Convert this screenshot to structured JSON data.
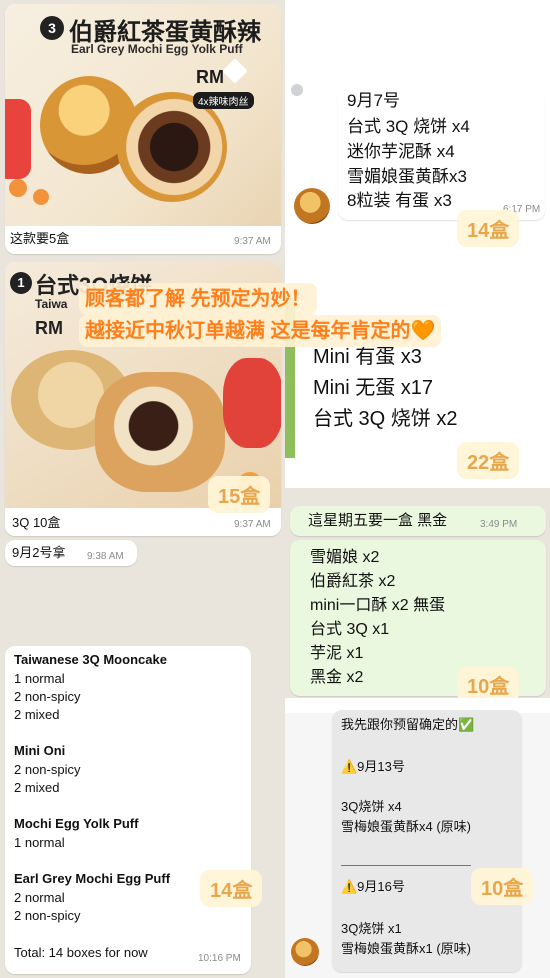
{
  "panel1": {
    "number_badge": "3",
    "product_cn": "伯爵紅茶蛋黄酥辣",
    "product_en": "Earl Grey Mochi Egg Yolk Puff",
    "price_partial": "RM",
    "subtitle": "4x辣味肉丝",
    "caption": "这款要5盒",
    "time": "9:37 AM"
  },
  "panel2": {
    "lines": [
      "9月7号",
      "台式 3Q 烧饼 x4",
      "迷你芋泥酥 x4",
      "雪媚娘蛋黄酥x3",
      "8粒装 有蛋 x3"
    ],
    "time": "6:17 PM",
    "count": "14盒"
  },
  "panel3": {
    "badge": "1",
    "product_cn": "台式3Q烧饼",
    "product_en": "Taiwa",
    "price_partial": "RM",
    "caption": "3Q 10盒",
    "time": "9:37 AM",
    "count": "15盒"
  },
  "panel3_2": {
    "text": "9月2号拿",
    "time": "9:38 AM"
  },
  "banner": {
    "line1": "顾客都了解 先预定为妙！",
    "line2": "越接近中秋订单越满 这是每年肯定的🧡"
  },
  "panel4": {
    "lines": [
      "Mini 有蛋 x3",
      "Mini 无蛋 x17",
      "台式 3Q 烧饼 x2"
    ],
    "count": "22盒"
  },
  "panel5": {
    "header": "這星期五要一盒 黑金",
    "time": "3:49 PM",
    "lines": [
      "雪媚娘 x2",
      "伯爵紅茶 x2",
      "mini一口酥 x2 無蛋",
      "台式 3Q x1",
      "芋泥 x1",
      "黑金 x2"
    ],
    "count": "10盒"
  },
  "panel6": {
    "sections": [
      {
        "title": "Taiwanese 3Q Mooncake",
        "items": [
          "1 normal",
          "2 non-spicy",
          "2 mixed"
        ]
      },
      {
        "title": "Mini Oni",
        "items": [
          "2 non-spicy",
          "2 mixed"
        ]
      },
      {
        "title": "Mochi Egg Yolk Puff",
        "items": [
          "1 normal"
        ]
      },
      {
        "title": "Earl Grey Mochi Egg Puff",
        "items": [
          "2 normal",
          "2 non-spicy"
        ]
      }
    ],
    "total": "Total: 14 boxes for now",
    "time": "10:16 PM",
    "count": "14盒"
  },
  "panel7": {
    "intro": "我先跟你预留确定的✅",
    "date1": "⚠️9月13号",
    "date1_items": [
      "3Q烧饼 x4",
      "雪梅娘蛋黄酥x4 (原味)"
    ],
    "divider": "——————————",
    "date2": "⚠️9月16号",
    "date2_items": [
      "3Q烧饼 x1",
      "雪梅娘蛋黄酥x1 (原味)"
    ],
    "count": "10盒"
  }
}
